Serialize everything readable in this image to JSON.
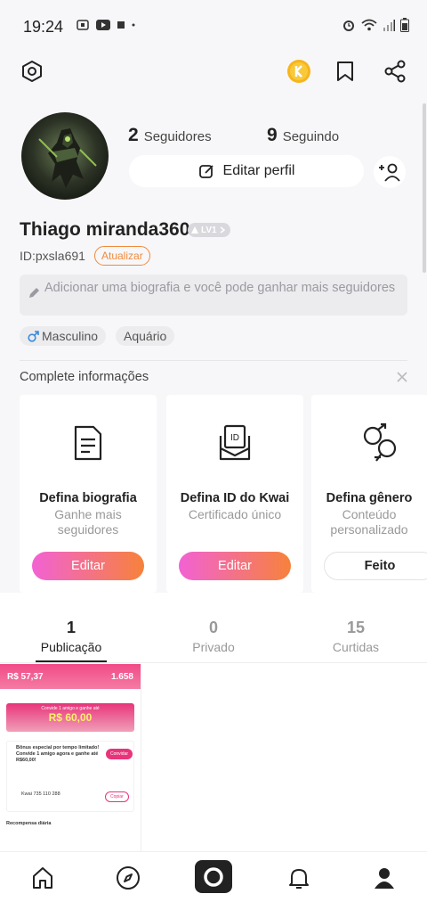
{
  "status_bar": {
    "time": "19:24"
  },
  "header": {},
  "profile": {
    "followers_count": "2",
    "followers_label": "Seguidores",
    "following_count": "9",
    "following_label": "Seguindo",
    "edit_profile_label": "Editar perfil",
    "username": "Thiago miranda360",
    "level": "LV1",
    "user_id": "ID:pxsla691",
    "update_label": "Atualizar",
    "bio_placeholder": "Adicionar uma biografia e você pode ganhar mais seguidores",
    "tags": [
      {
        "label": "Masculino",
        "icon": "male-icon"
      },
      {
        "label": "Aquário"
      }
    ]
  },
  "complete_info": {
    "title": "Complete informações",
    "cards": [
      {
        "icon": "document-icon",
        "title": "Defina biografia",
        "subtitle": "Ganhe mais seguidores",
        "button": "Editar"
      },
      {
        "icon": "id-card-icon",
        "title": "Defina ID do Kwai",
        "subtitle": "Certificado único",
        "button": "Editar"
      },
      {
        "icon": "gender-icon",
        "title": "Defina gênero",
        "subtitle": "Conteúdo personalizado",
        "button": "Feito"
      }
    ]
  },
  "tabs": [
    {
      "count": "1",
      "label": "Publicação",
      "active": true
    },
    {
      "count": "0",
      "label": "Privado",
      "active": false
    },
    {
      "count": "15",
      "label": "Curtidas",
      "active": false
    }
  ],
  "post_thumbnail": {
    "balance": "R$ 57,37",
    "coins": "1.658",
    "banner_line": "Convide 1 amigo e ganhe até",
    "banner_amount": "R$ 60,00",
    "bonus_text": "Bônus especial por tempo limitado! Convide 1 amigo agora e ganhe até R$60,00!",
    "invite_button": "Convidar",
    "kwai_id": "Kwai 735 110 288",
    "copy_button": "Copiar",
    "footer": "Recompensa diária"
  },
  "colors": {
    "accent_orange": "#f08a3b",
    "gradient_start": "#f262d4",
    "gradient_end": "#f6823b"
  },
  "bottom_nav": [
    "home-icon",
    "explore-icon",
    "camera-icon",
    "notifications-icon",
    "profile-icon"
  ]
}
